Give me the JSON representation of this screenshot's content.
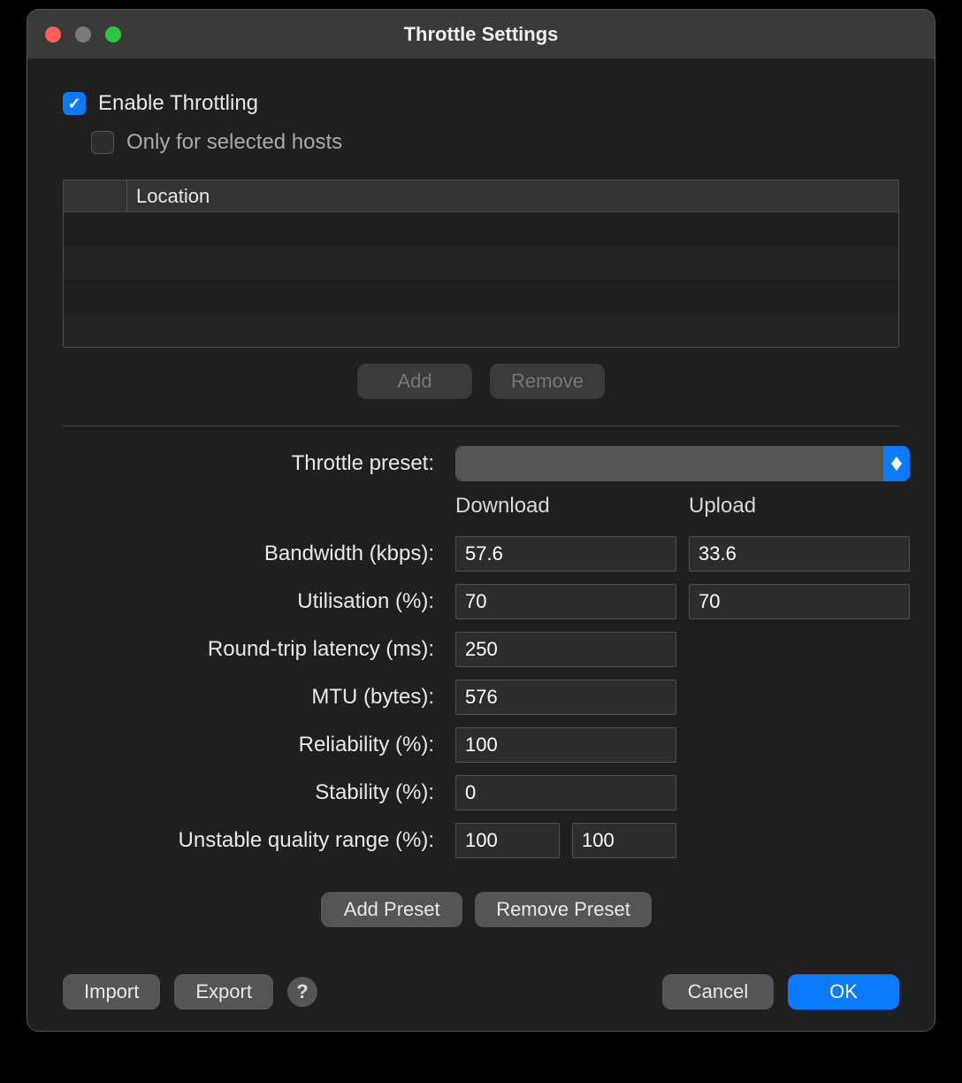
{
  "window": {
    "title": "Throttle Settings"
  },
  "top": {
    "enable_label": "Enable Throttling",
    "only_hosts_label": "Only for selected hosts",
    "enable_checked": true,
    "only_hosts_checked": false
  },
  "hosts": {
    "header": {
      "location": "Location"
    },
    "add": "Add",
    "remove": "Remove"
  },
  "form": {
    "preset_label": "Throttle preset:",
    "preset_value": "",
    "download_header": "Download",
    "upload_header": "Upload",
    "rows": {
      "bandwidth": {
        "label": "Bandwidth (kbps):",
        "download": "57.6",
        "upload": "33.6"
      },
      "utilisation": {
        "label": "Utilisation (%):",
        "download": "70",
        "upload": "70"
      },
      "latency": {
        "label": "Round-trip latency (ms):",
        "value": "250"
      },
      "mtu": {
        "label": "MTU (bytes):",
        "value": "576"
      },
      "reliability": {
        "label": "Reliability (%):",
        "value": "100"
      },
      "stability": {
        "label": "Stability (%):",
        "value": "0"
      },
      "uqr": {
        "label": "Unstable quality range (%):",
        "a": "100",
        "b": "100"
      }
    },
    "add_preset": "Add Preset",
    "remove_preset": "Remove Preset"
  },
  "footer": {
    "import": "Import",
    "export": "Export",
    "help": "?",
    "cancel": "Cancel",
    "ok": "OK"
  }
}
